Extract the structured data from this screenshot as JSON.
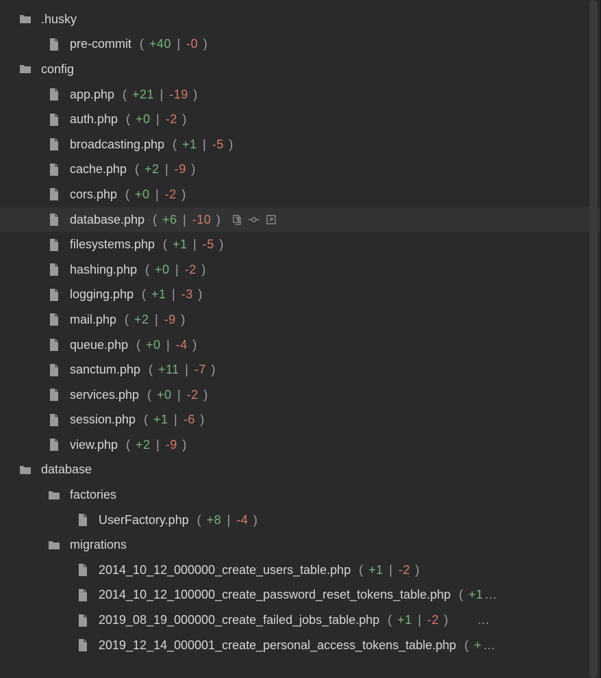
{
  "tree": [
    {
      "type": "folder",
      "name": ".husky",
      "indent": 0
    },
    {
      "type": "file",
      "name": "pre-commit",
      "indent": 1,
      "add": "+40",
      "del": "-0"
    },
    {
      "type": "folder",
      "name": "config",
      "indent": 0
    },
    {
      "type": "file",
      "name": "app.php",
      "indent": 1,
      "add": "+21",
      "del": "-19"
    },
    {
      "type": "file",
      "name": "auth.php",
      "indent": 1,
      "add": "+0",
      "del": "-2"
    },
    {
      "type": "file",
      "name": "broadcasting.php",
      "indent": 1,
      "add": "+1",
      "del": "-5"
    },
    {
      "type": "file",
      "name": "cache.php",
      "indent": 1,
      "add": "+2",
      "del": "-9"
    },
    {
      "type": "file",
      "name": "cors.php",
      "indent": 1,
      "add": "+0",
      "del": "-2"
    },
    {
      "type": "file",
      "name": "database.php",
      "indent": 1,
      "add": "+6",
      "del": "-10",
      "selected": true,
      "actions": true
    },
    {
      "type": "file",
      "name": "filesystems.php",
      "indent": 1,
      "add": "+1",
      "del": "-5"
    },
    {
      "type": "file",
      "name": "hashing.php",
      "indent": 1,
      "add": "+0",
      "del": "-2"
    },
    {
      "type": "file",
      "name": "logging.php",
      "indent": 1,
      "add": "+1",
      "del": "-3"
    },
    {
      "type": "file",
      "name": "mail.php",
      "indent": 1,
      "add": "+2",
      "del": "-9"
    },
    {
      "type": "file",
      "name": "queue.php",
      "indent": 1,
      "add": "+0",
      "del": "-4"
    },
    {
      "type": "file",
      "name": "sanctum.php",
      "indent": 1,
      "add": "+11",
      "del": "-7"
    },
    {
      "type": "file",
      "name": "services.php",
      "indent": 1,
      "add": "+0",
      "del": "-2"
    },
    {
      "type": "file",
      "name": "session.php",
      "indent": 1,
      "add": "+1",
      "del": "-6"
    },
    {
      "type": "file",
      "name": "view.php",
      "indent": 1,
      "add": "+2",
      "del": "-9"
    },
    {
      "type": "folder",
      "name": "database",
      "indent": 0
    },
    {
      "type": "folder",
      "name": "factories",
      "indent": 1
    },
    {
      "type": "file",
      "name": "UserFactory.php",
      "indent": 2,
      "add": "+8",
      "del": "-4"
    },
    {
      "type": "folder",
      "name": "migrations",
      "indent": 1
    },
    {
      "type": "file",
      "name": "2014_10_12_000000_create_users_table.php",
      "indent": 2,
      "add": "+1",
      "del": "-2"
    },
    {
      "type": "file",
      "name": "2014_10_12_100000_create_password_reset_tokens_table.php",
      "indent": 2,
      "truncated": "( +1…"
    },
    {
      "type": "file",
      "name": "2019_08_19_000000_create_failed_jobs_table.php",
      "indent": 2,
      "add": "+1",
      "del": "-2",
      "trailingEllipsis": true
    },
    {
      "type": "file",
      "name": "2019_12_14_000001_create_personal_access_tokens_table.php",
      "indent": 2,
      "truncated": "( +…"
    }
  ],
  "parenOpen": "(",
  "parenClose": ")",
  "sep": "|",
  "ellipsis": "…"
}
